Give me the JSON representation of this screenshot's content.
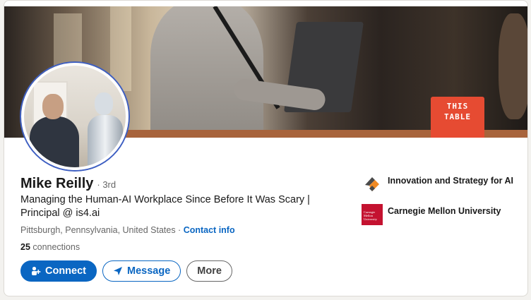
{
  "profile": {
    "name": "Mike Reilly",
    "degree": "· 3rd",
    "headline": "Managing the Human-AI Workplace Since Before It Was Scary | Principal @ is4.ai",
    "location": "Pittsburgh, Pennsylvania, United States",
    "separator": " · ",
    "contact_info": "Contact info",
    "connections_count": "25",
    "connections_label": " connections"
  },
  "cover": {
    "sign_line1": "THIS",
    "sign_line2": "TABLE"
  },
  "actions": {
    "connect": "Connect",
    "message": "Message",
    "more": "More"
  },
  "organizations": [
    {
      "name": "Innovation and Strategy for AI",
      "icon": "innovation-logo"
    },
    {
      "name": "Carnegie Mellon University",
      "icon": "cmu-logo",
      "logo_text": "Carnegie Mellon University"
    }
  ],
  "colors": {
    "accent": "#0a66c2",
    "avatar_ring": "#3e5fc2",
    "cmu_red": "#c41230",
    "innovation_orange": "#f08a24"
  }
}
